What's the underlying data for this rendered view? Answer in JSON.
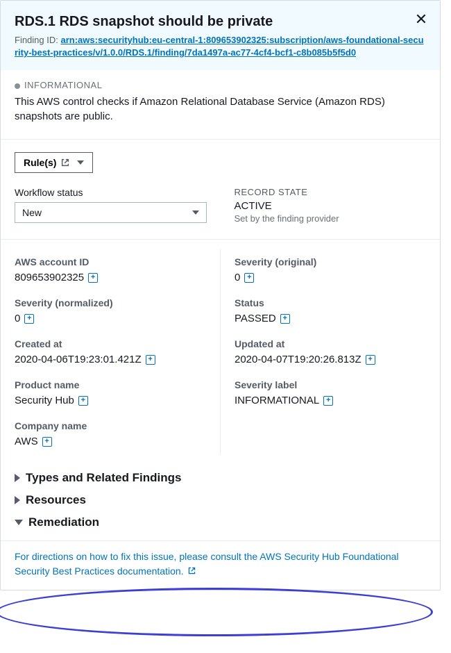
{
  "header": {
    "title": "RDS.1 RDS snapshot should be private",
    "finding_id_label": "Finding ID: ",
    "finding_id_value": "arn:aws:securityhub:eu-central-1:809653902325:subscription/aws-foundational-security-best-practices/v/1.0.0/RDS.1/finding/7da1497a-ac77-4cf4-bcf1-c8b085b5f5d0"
  },
  "description": {
    "severity_name": "INFORMATIONAL",
    "text": "This AWS control checks if Amazon Relational Database Service (Amazon RDS) snapshots are public."
  },
  "controls": {
    "rules_label": "Rule(s)",
    "workflow_label": "Workflow status",
    "workflow_value": "New",
    "record_state_label": "RECORD STATE",
    "record_state_value": "ACTIVE",
    "record_state_sub": "Set by the finding provider"
  },
  "details": [
    {
      "left_label": "AWS account ID",
      "left_value": "809653902325",
      "right_label": "Severity (original)",
      "right_value": "0"
    },
    {
      "left_label": "Severity (normalized)",
      "left_value": "0",
      "right_label": "Status",
      "right_value": "PASSED"
    },
    {
      "left_label": "Created at",
      "left_value": "2020-04-06T19:23:01.421Z",
      "right_label": "Updated at",
      "right_value": "2020-04-07T19:20:26.813Z"
    },
    {
      "left_label": "Product name",
      "left_value": "Security Hub",
      "right_label": "Severity label",
      "right_value": "INFORMATIONAL"
    },
    {
      "left_label": "Company name",
      "left_value": "AWS",
      "right_label": "",
      "right_value": ""
    }
  ],
  "sections": {
    "types": "Types and Related Findings",
    "resources": "Resources",
    "remediation": "Remediation",
    "remediation_text": "For directions on how to fix this issue, please consult the AWS Security Hub Foundational Security Best Practices documentation."
  }
}
